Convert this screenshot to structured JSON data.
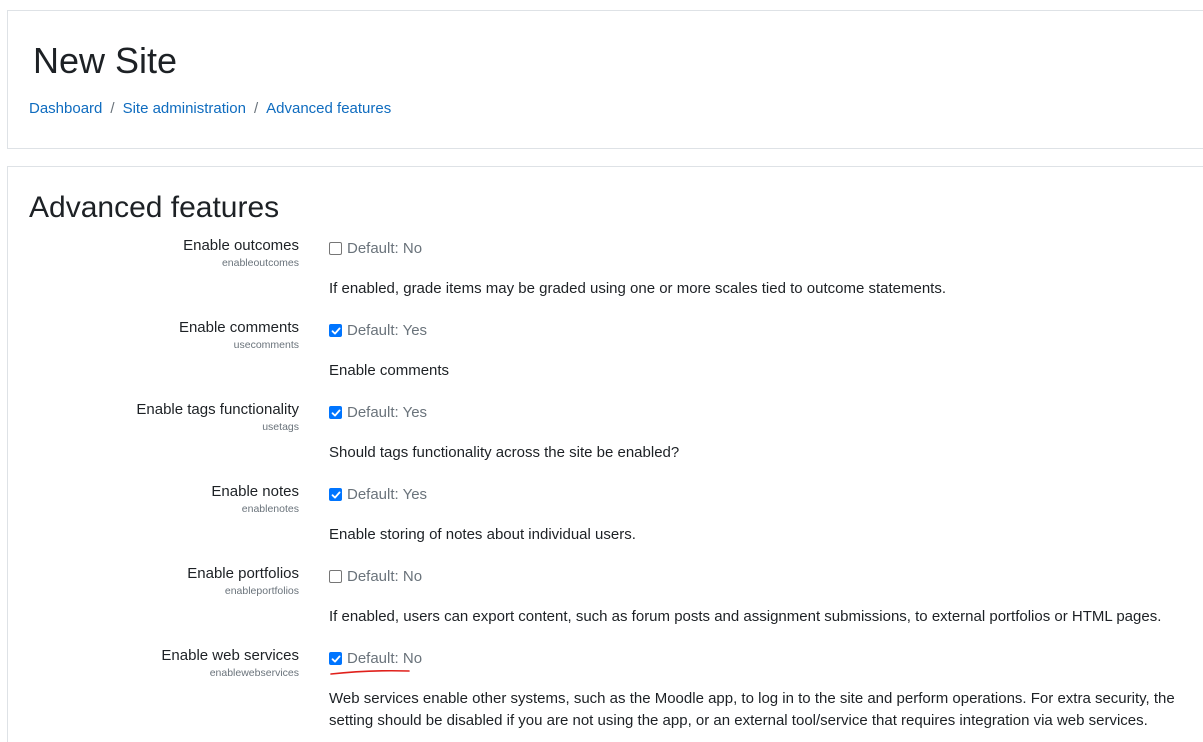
{
  "header": {
    "site_title": "New Site",
    "breadcrumb": [
      {
        "label": "Dashboard"
      },
      {
        "label": "Site administration"
      },
      {
        "label": "Advanced features"
      }
    ],
    "separator": "/"
  },
  "section": {
    "title": "Advanced features"
  },
  "settings": [
    {
      "label": "Enable outcomes",
      "key": "enableoutcomes",
      "checked": false,
      "default_text": "Default: No",
      "description": "If enabled, grade items may be graded using one or more scales tied to outcome statements."
    },
    {
      "label": "Enable comments",
      "key": "usecomments",
      "checked": true,
      "default_text": "Default: Yes",
      "description": "Enable comments"
    },
    {
      "label": "Enable tags functionality",
      "key": "usetags",
      "checked": true,
      "default_text": "Default: Yes",
      "description": "Should tags functionality across the site be enabled?"
    },
    {
      "label": "Enable notes",
      "key": "enablenotes",
      "checked": true,
      "default_text": "Default: Yes",
      "description": "Enable storing of notes about individual users."
    },
    {
      "label": "Enable portfolios",
      "key": "enableportfolios",
      "checked": false,
      "default_text": "Default: No",
      "description": "If enabled, users can export content, such as forum posts and assignment submissions, to external portfolios or HTML pages."
    },
    {
      "label": "Enable web services",
      "key": "enablewebservices",
      "checked": true,
      "default_text": "Default: No",
      "description": "Web services enable other systems, such as the Moodle app, to log in to the site and perform operations. For extra security, the setting should be disabled if you are not using the app, or an external tool/service that requires integration via web services."
    }
  ],
  "colors": {
    "link": "#0f6cbf",
    "checkbox_checked": "#0075ff",
    "annotation": "#e0201b"
  }
}
